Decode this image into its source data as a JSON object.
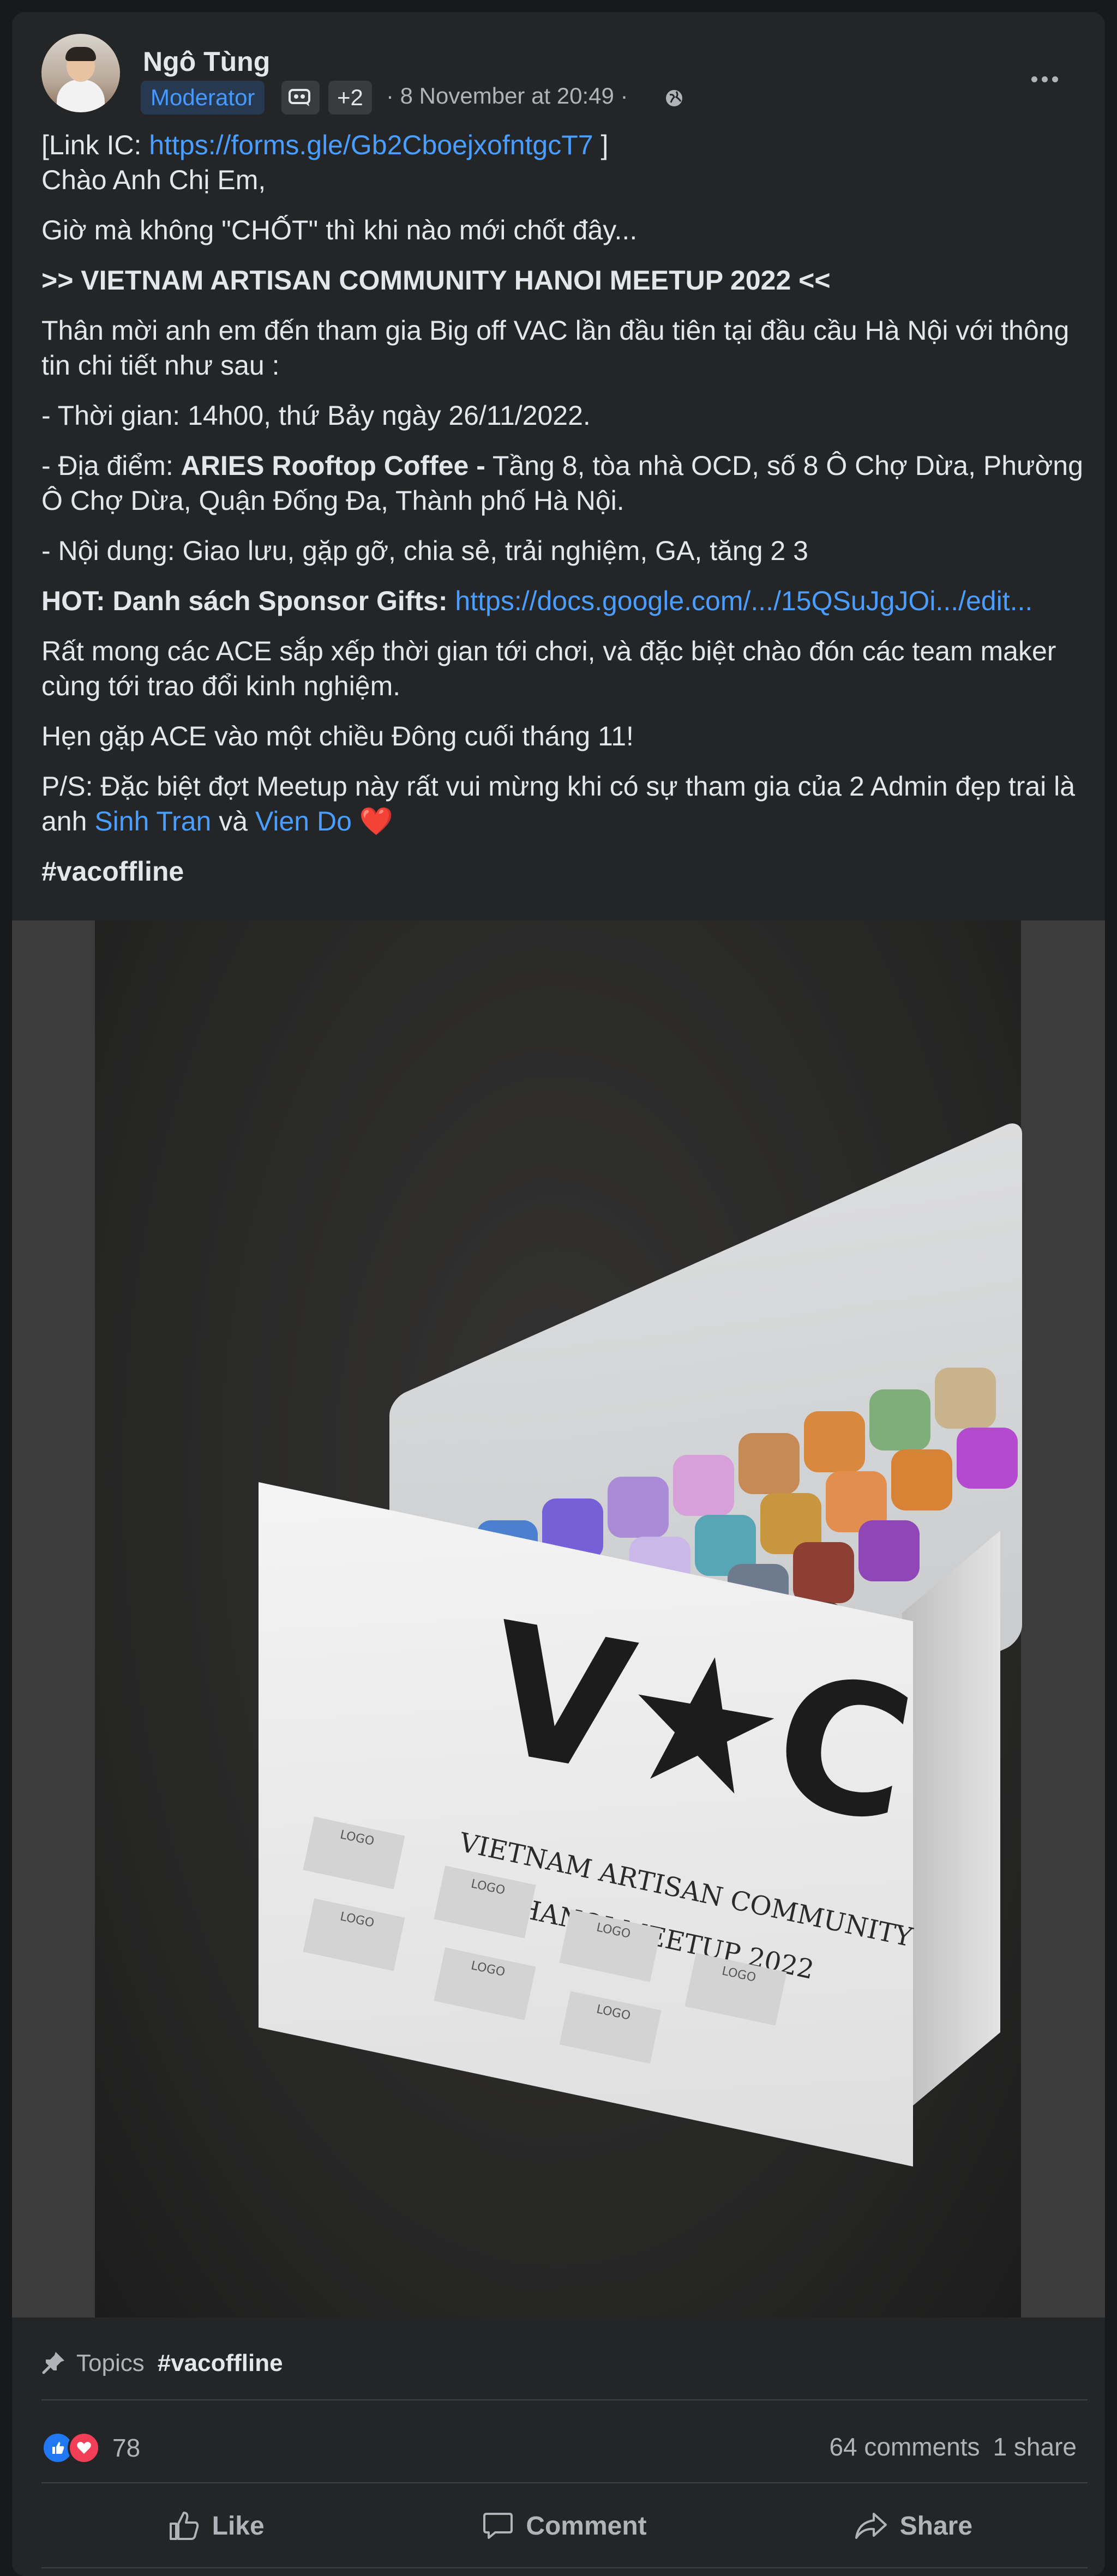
{
  "post": {
    "author": "Ngô Tùng",
    "role_badge": "Moderator",
    "extra_badges": "+2",
    "timestamp": "· 8 November at 20:49 ·",
    "audience_icon": "globe-icon",
    "menu_icon": "more-icon"
  },
  "body": {
    "link_prefix": "[Link IC: ",
    "link_url": "https://forms.gle/Gb2CboejxofntgcT7",
    "link_suffix": " ]",
    "greeting": "Chào Anh Chị Em,",
    "line2": "Giờ mà không \"CHỐT\" thì khi nào mới chốt đây...",
    "headline": ">> VIETNAM ARTISAN COMMUNITY HANOI MEETUP 2022 <<",
    "invite": "Thân mời anh em đến tham gia Big off VAC lần đầu tiên tại đầu cầu Hà Nội với thông tin chi tiết như sau :",
    "time": "- Thời gian: 14h00, thứ Bảy ngày 26/11/2022.",
    "place_prefix": "- Địa điểm: ",
    "place_bold": "ARIES Rooftop Coffee -",
    "place_rest": " Tầng 8, tòa nhà OCD, số 8 Ô Chợ Dừa, Phường Ô Chợ Dừa, Quận Đống Đa, Thành phố Hà Nội.",
    "content": "- Nội dung: Giao lưu, gặp gỡ, chia sẻ, trải nghiệm, GA, tăng 2 3",
    "sponsor_label": "HOT: Danh sách Sponsor Gifts:",
    "sponsor_link": "https://docs.google.com/.../15QSuJgJOi.../edit...",
    "hope": "Rất mong các ACE sắp xếp thời gian tới chơi, và đặc biệt chào đón các team maker cùng tới trao đổi kinh nghiệm.",
    "see_you": "Hẹn gặp ACE vào một chiều Đông cuối tháng 11!",
    "ps_text": "P/S: Đặc biệt đợt Meetup này rất vui mừng khi có sự tham gia của 2 Admin đẹp trai là anh ",
    "mention1": "Sinh Tran",
    "and_word": " và ",
    "mention2": "Vien Do",
    "heart": " ❤️",
    "hashtag": "#vacoffline"
  },
  "photo": {
    "card_logo": "V★C",
    "card_line1": "VIETNAM ARTISAN COMMUNITY",
    "card_line2": "HANOI MEETUP 2022",
    "logo_placeholder": "LOGO"
  },
  "topics": {
    "label": "Topics",
    "tag": "#vacoffline",
    "icon": "pin-icon"
  },
  "engagement": {
    "reaction_count": "78",
    "comments": "64 comments",
    "shares": "1 share"
  },
  "actions": {
    "like": "Like",
    "comment": "Comment",
    "share": "Share"
  },
  "colors": {
    "card_bg": "#242526",
    "link": "#4a9eff",
    "moderator_text": "#4599ff",
    "secondary_text": "#b0b3b8"
  }
}
